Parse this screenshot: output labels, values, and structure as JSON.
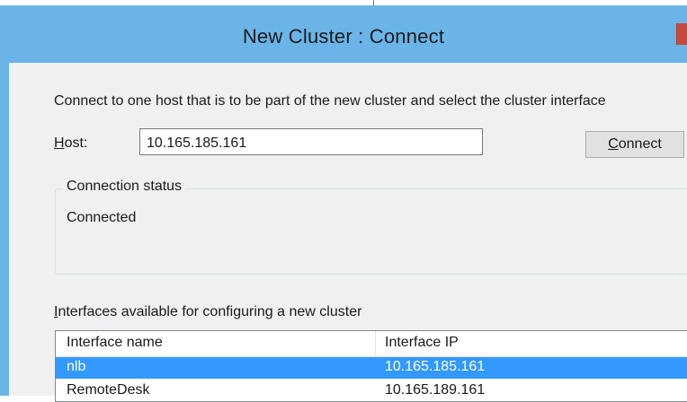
{
  "window": {
    "title": "New Cluster : Connect"
  },
  "instructions": "Connect to one host that is to be part of the new cluster and select the cluster interface",
  "host": {
    "label_access_key": "H",
    "label_rest": "ost:",
    "value": "10.165.185.161"
  },
  "connect_button": {
    "access_key": "C",
    "rest": "onnect"
  },
  "connection_status": {
    "group_label": "Connection status",
    "status": "Connected"
  },
  "interfaces": {
    "label_access_key": "I",
    "label_rest": "nterfaces available for configuring a new cluster",
    "columns": [
      "Interface name",
      "Interface IP"
    ],
    "rows": [
      {
        "name": "nlb",
        "ip": "10.165.185.161",
        "selected": true
      },
      {
        "name": "RemoteDesk",
        "ip": "10.165.189.161",
        "selected": false
      }
    ]
  },
  "colors": {
    "titlebar": "#6ab4e8",
    "selection": "#3399ff",
    "close": "#c7493e"
  }
}
